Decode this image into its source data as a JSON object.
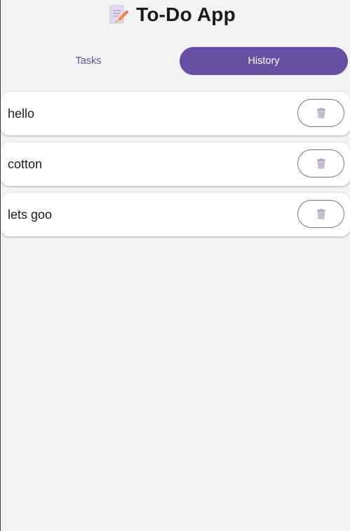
{
  "app": {
    "title": "To-Do App",
    "icon": "memo-pencil-icon"
  },
  "tabs": [
    {
      "label": "Tasks",
      "active": false
    },
    {
      "label": "History",
      "active": true
    }
  ],
  "history": {
    "items": [
      {
        "text": "hello",
        "action_icon": "trash-icon"
      },
      {
        "text": "cotton",
        "action_icon": "trash-icon"
      },
      {
        "text": "lets goo",
        "action_icon": "trash-icon"
      }
    ]
  },
  "colors": {
    "accent": "#6750a4",
    "tab_inactive_text": "#65509e",
    "background": "#f3f3f3",
    "card": "#ffffff",
    "button_outline": "#79747e"
  }
}
